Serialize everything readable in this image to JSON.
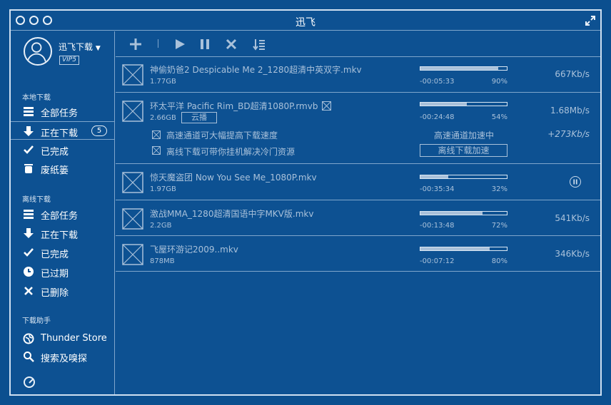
{
  "window": {
    "title": "迅飞"
  },
  "user": {
    "name": "迅飞下载",
    "vip": "VIP5"
  },
  "sidebar": {
    "local_title": "本地下载",
    "local_items": [
      {
        "label": "全部任务",
        "icon": "list-icon"
      },
      {
        "label": "正在下载",
        "icon": "download-arrow-icon",
        "badge": "5"
      },
      {
        "label": "已完成",
        "icon": "check-icon"
      },
      {
        "label": "废纸篓",
        "icon": "trash-icon"
      }
    ],
    "offline_title": "离线下载",
    "offline_items": [
      {
        "label": "全部任务",
        "icon": "list-icon"
      },
      {
        "label": "正在下载",
        "icon": "download-arrow-icon"
      },
      {
        "label": "已完成",
        "icon": "check-icon"
      },
      {
        "label": "已过期",
        "icon": "clock-icon"
      },
      {
        "label": "已删除",
        "icon": "x-icon"
      }
    ],
    "assistant_title": "下载助手",
    "assistant_items": [
      {
        "label": "Thunder Store",
        "icon": "globe-icon"
      },
      {
        "label": "搜索及嗅探",
        "icon": "search-icon"
      }
    ]
  },
  "tasks": [
    {
      "name": "神偷奶爸2 Despicable Me 2_1280超清中英双字.mkv",
      "size": "1.77GB",
      "progress": 0.9,
      "remaining": "-00:05:33",
      "percent": "90%",
      "speed": "667Kb/s"
    },
    {
      "name": "环太平洋 Pacific Rim_BD超清1080P.rmvb",
      "size": "2.66GB",
      "progress": 0.54,
      "remaining": "-00:24:48",
      "percent": "54%",
      "speed": "1.68Mb/s",
      "cloud": "云播",
      "options": [
        {
          "label": "高速通道可大幅提高下载速度",
          "status": "高速通道加速中",
          "extra": "+273Kb/s"
        },
        {
          "label": "离线下载可带你挂机解决冷门资源",
          "button": "离线下载加速"
        }
      ]
    },
    {
      "name": "惊天魔盗团 Now You See Me_1080P.mkv",
      "size": "1.97GB",
      "progress": 0.32,
      "remaining": "-00:35:34",
      "percent": "32%",
      "speed": ""
    },
    {
      "name": "激战MMA_1280超清国语中字MKV版.mkv",
      "size": "2.2GB",
      "progress": 0.72,
      "remaining": "-00:13:48",
      "percent": "72%",
      "speed": "541Kb/s"
    },
    {
      "name": "飞屋环游记2009..mkv",
      "size": "878MB",
      "progress": 0.8,
      "remaining": "-00:07:12",
      "percent": "80%",
      "speed": "346Kb/s"
    }
  ]
}
